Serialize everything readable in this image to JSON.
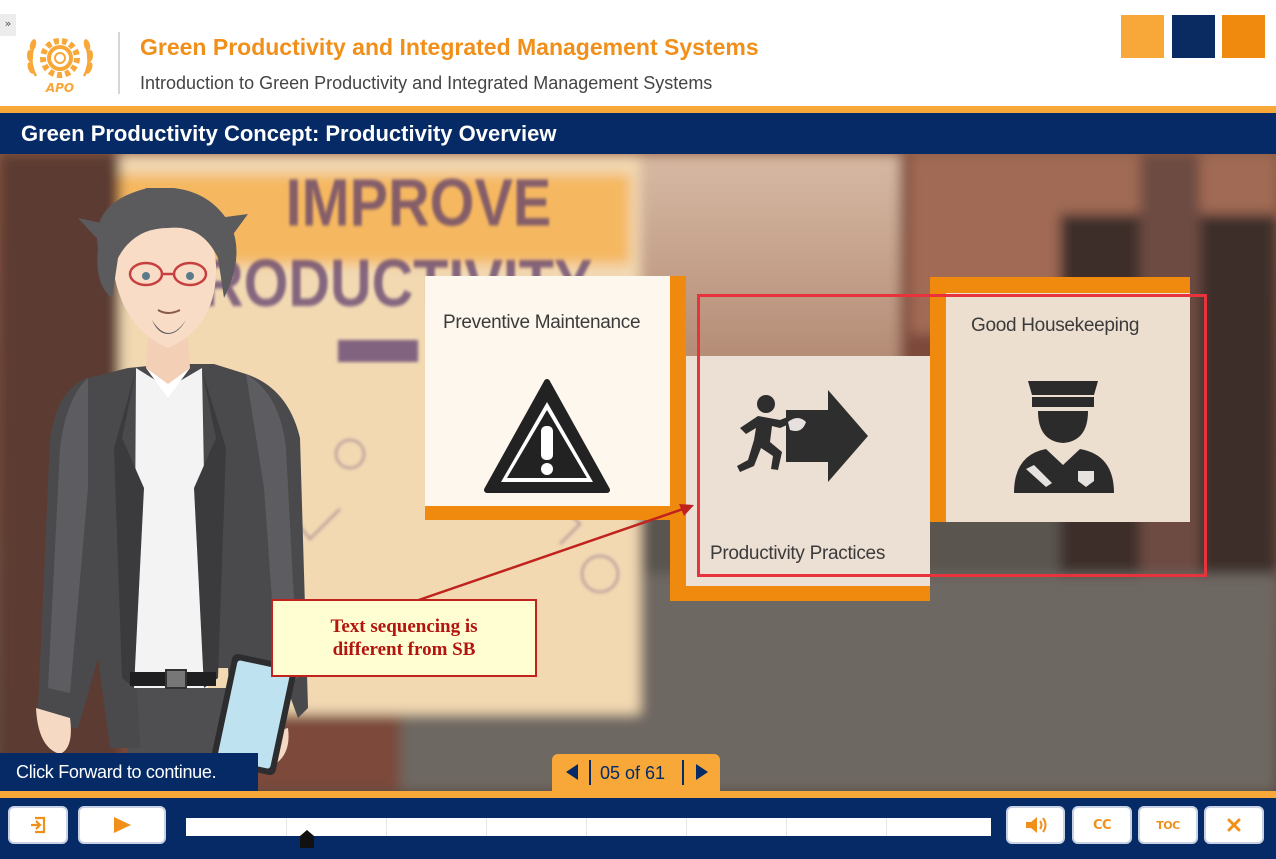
{
  "header": {
    "expand_glyph": "»",
    "logo": "APO",
    "course_title": "Green Productivity and Integrated Management Systems",
    "course_subtitle": "Introduction to Green Productivity and Integrated Management Systems",
    "brand_colors": [
      "#f7a838",
      "#0a2a62",
      "#ef8a0e"
    ]
  },
  "slide": {
    "title": "Green Productivity Concept: Productivity Overview",
    "background_sign": {
      "line1": "IMPROVE",
      "line2": "PRODUCTIVITY"
    }
  },
  "cards": [
    {
      "label": "Preventive Maintenance",
      "icon": "warning-triangle-icon"
    },
    {
      "label": "Productivity Practices",
      "icon": "running-person-arrow-icon"
    },
    {
      "label": "Good Housekeeping",
      "icon": "security-guard-icon"
    }
  ],
  "annotation": {
    "text": "Text sequencing is different from SB",
    "color": "#c0221e",
    "box_color": "#e8323c"
  },
  "status": {
    "text": "Click Forward to continue."
  },
  "pager": {
    "text": "05 of 61",
    "current": 5,
    "total": 61
  },
  "controls": {
    "exit": "exit-icon",
    "play": "play-icon",
    "volume": "volume-icon",
    "cc_label": "CC",
    "toc_label": "TOC",
    "close": "close-icon",
    "seek_progress_percent": 15
  },
  "colors": {
    "navy": "#052a66",
    "orange": "#f7a838",
    "dark_orange": "#ef8a0e"
  }
}
